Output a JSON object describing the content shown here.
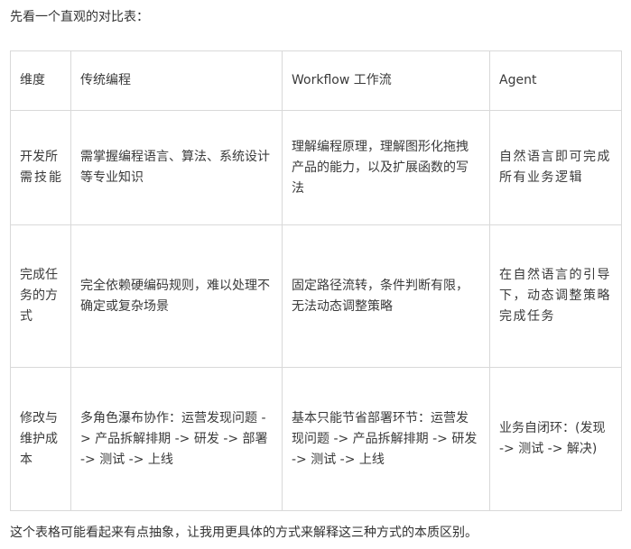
{
  "intro": "先看一个直观的对比表：",
  "outro": "这个表格可能看起来有点抽象，让我用更具体的方式来解释这三种方式的本质区别。",
  "table": {
    "headers": [
      "维度",
      "传统编程",
      "Workflow 工作流",
      "Agent"
    ],
    "rows": [
      {
        "label": "开发所需技能",
        "cells": [
          "需掌握编程语言、算法、系统设计等专业知识",
          "理解编程原理，理解图形化拖拽产品的能力，以及扩展函数的写法",
          "自然语言即可完成所有业务逻辑"
        ]
      },
      {
        "label": "完成任务的方式",
        "cells": [
          "完全依赖硬编码规则，难以处理不确定或复杂场景",
          "固定路径流转，条件判断有限，无法动态调整策略",
          "在自然语言的引导下，动态调整策略完成任务"
        ]
      },
      {
        "label": "修改与维护成本",
        "cells": [
          "多角色瀑布协作：运营发现问题 -> 产品拆解排期 -> 研发 -> 部署 -> 测试 -> 上线",
          "基本只能节省部署环节：运营发现问题 -> 产品拆解排期 -> 研发 -> 测试 -> 上线",
          "业务自闭环：(发现 -> 测试 -> 解决)"
        ]
      }
    ]
  }
}
